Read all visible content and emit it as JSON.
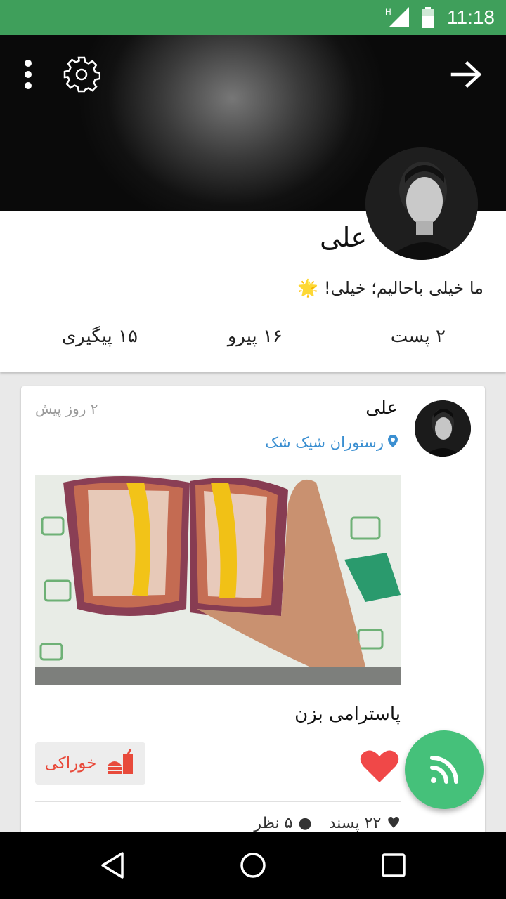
{
  "status_bar": {
    "time": "11:18",
    "network_label": "H",
    "icons": [
      "signal-icon",
      "battery-icon"
    ]
  },
  "header": {
    "icons": [
      "more-vert-icon",
      "settings-gear-icon",
      "arrow-forward-icon"
    ]
  },
  "profile": {
    "name": "علی",
    "bio": "ما خیلی باحالیم؛ خیلی!",
    "bio_emoji": "🌟",
    "stats": {
      "posts": "۲ پست",
      "followers": "۱۶ پیرو",
      "following": "۱۵ پیگیری"
    }
  },
  "post": {
    "author": "علی",
    "time": "۲ روز پیش",
    "location": "رستوران شیک شک",
    "caption": "پاسترامی بزن",
    "category": "خوراکی",
    "likes": "۲۲ پسند",
    "comments": "۵ نظر",
    "liked": true
  },
  "colors": {
    "status_bar": "#3f9f5b",
    "accent_green": "#45c17a",
    "link_blue": "#3b8fd1",
    "like_red": "#f04848",
    "category_red": "#e84a3b"
  },
  "nav_bar": {
    "icons": [
      "back-icon",
      "home-icon",
      "recents-icon"
    ]
  }
}
